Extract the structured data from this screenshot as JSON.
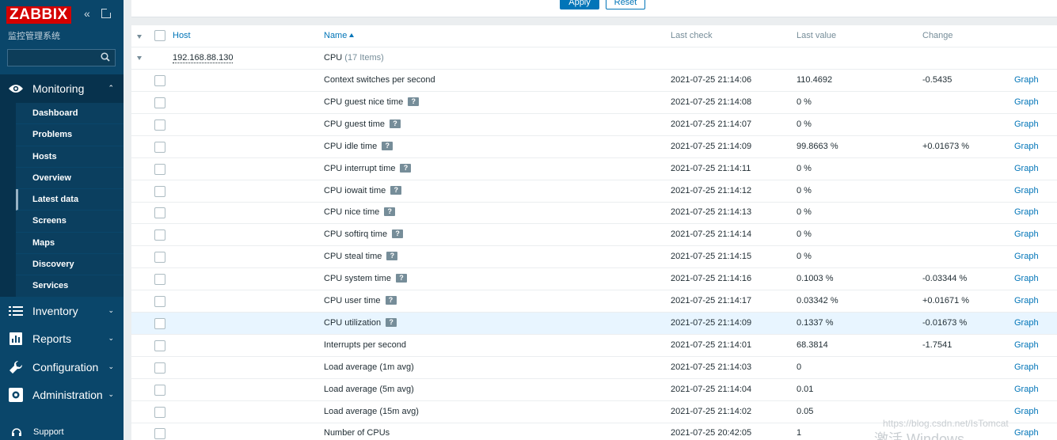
{
  "sidebar": {
    "logo": "ZABBIX",
    "server_name": "监控管理系统",
    "search_value": "",
    "sections": [
      {
        "label": "Monitoring",
        "icon": "eye-icon",
        "expanded": true
      },
      {
        "label": "Inventory",
        "icon": "list-icon"
      },
      {
        "label": "Reports",
        "icon": "bar-chart-icon"
      },
      {
        "label": "Configuration",
        "icon": "wrench-icon"
      },
      {
        "label": "Administration",
        "icon": "gear-icon"
      }
    ],
    "monitoring_items": [
      "Dashboard",
      "Problems",
      "Hosts",
      "Overview",
      "Latest data",
      "Screens",
      "Maps",
      "Discovery",
      "Services"
    ],
    "selected_item": "Latest data",
    "support": "Support"
  },
  "filter": {
    "apply": "Apply",
    "reset": "Reset"
  },
  "table": {
    "headers": {
      "host": "Host",
      "name": "Name",
      "last_check": "Last check",
      "last_value": "Last value",
      "change": "Change"
    },
    "host": "192.168.88.130",
    "application": "CPU",
    "application_count": "(17 Items)",
    "graph_label": "Graph",
    "rows": [
      {
        "name": "Context switches per second",
        "hint": false,
        "last_check": "2021-07-25 21:14:06",
        "last_value": "110.4692",
        "change": "-0.5435"
      },
      {
        "name": "CPU guest nice time",
        "hint": true,
        "last_check": "2021-07-25 21:14:08",
        "last_value": "0 %",
        "change": ""
      },
      {
        "name": "CPU guest time",
        "hint": true,
        "last_check": "2021-07-25 21:14:07",
        "last_value": "0 %",
        "change": ""
      },
      {
        "name": "CPU idle time",
        "hint": true,
        "last_check": "2021-07-25 21:14:09",
        "last_value": "99.8663 %",
        "change": "+0.01673 %"
      },
      {
        "name": "CPU interrupt time",
        "hint": true,
        "last_check": "2021-07-25 21:14:11",
        "last_value": "0 %",
        "change": ""
      },
      {
        "name": "CPU iowait time",
        "hint": true,
        "last_check": "2021-07-25 21:14:12",
        "last_value": "0 %",
        "change": ""
      },
      {
        "name": "CPU nice time",
        "hint": true,
        "last_check": "2021-07-25 21:14:13",
        "last_value": "0 %",
        "change": ""
      },
      {
        "name": "CPU softirq time",
        "hint": true,
        "last_check": "2021-07-25 21:14:14",
        "last_value": "0 %",
        "change": ""
      },
      {
        "name": "CPU steal time",
        "hint": true,
        "last_check": "2021-07-25 21:14:15",
        "last_value": "0 %",
        "change": ""
      },
      {
        "name": "CPU system time",
        "hint": true,
        "last_check": "2021-07-25 21:14:16",
        "last_value": "0.1003 %",
        "change": "-0.03344 %"
      },
      {
        "name": "CPU user time",
        "hint": true,
        "last_check": "2021-07-25 21:14:17",
        "last_value": "0.03342 %",
        "change": "+0.01671 %"
      },
      {
        "name": "CPU utilization",
        "hint": true,
        "last_check": "2021-07-25 21:14:09",
        "last_value": "0.1337 %",
        "change": "-0.01673 %",
        "highlight": true
      },
      {
        "name": "Interrupts per second",
        "hint": false,
        "last_check": "2021-07-25 21:14:01",
        "last_value": "68.3814",
        "change": "-1.7541"
      },
      {
        "name": "Load average (1m avg)",
        "hint": false,
        "last_check": "2021-07-25 21:14:03",
        "last_value": "0",
        "change": ""
      },
      {
        "name": "Load average (5m avg)",
        "hint": false,
        "last_check": "2021-07-25 21:14:04",
        "last_value": "0.01",
        "change": ""
      },
      {
        "name": "Load average (15m avg)",
        "hint": false,
        "last_check": "2021-07-25 21:14:02",
        "last_value": "0.05",
        "change": ""
      },
      {
        "name": "Number of CPUs",
        "hint": false,
        "last_check": "2021-07-25 20:42:05",
        "last_value": "1",
        "change": ""
      }
    ]
  },
  "watermark": "https://blog.csdn.net/IsTomcat",
  "activate_text": "激活 Windows"
}
